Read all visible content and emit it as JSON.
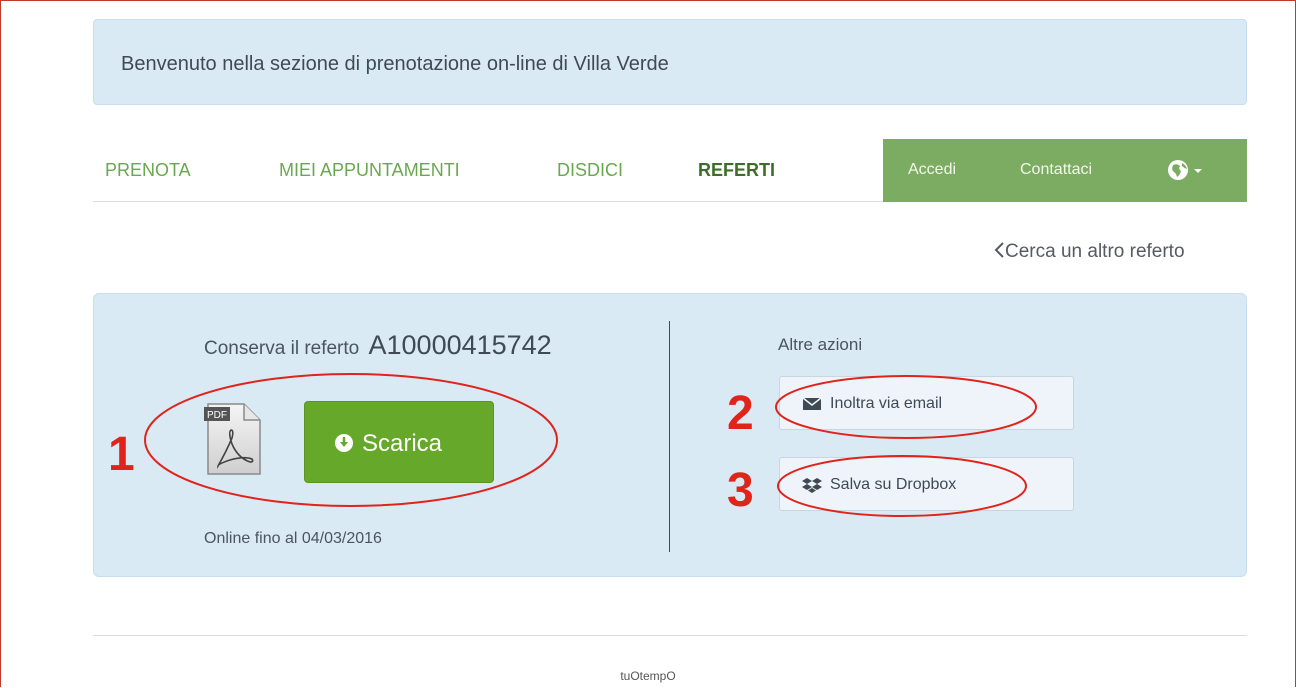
{
  "welcome": {
    "text": "Benvenuto nella sezione di prenotazione on-line di Villa Verde"
  },
  "nav": {
    "items": [
      {
        "label": "PRENOTA"
      },
      {
        "label": "MIEI APPUNTAMENTI"
      },
      {
        "label": "DISDICI"
      },
      {
        "label": "REFERTI",
        "active": true
      }
    ],
    "right": {
      "login": "Accedi",
      "contact": "Contattaci",
      "language_icon": "globe-icon"
    }
  },
  "back_link": {
    "label": "Cerca un altro referto",
    "icon": "chevron-left-icon"
  },
  "report": {
    "title_prefix": "Conserva il referto",
    "code": "A10000415742",
    "file_icon": "pdf-file-icon",
    "download_label": "Scarica",
    "download_icon": "download-circle-icon",
    "online_until": "Online fino al 04/03/2016"
  },
  "actions": {
    "title": "Altre azioni",
    "email_label": "Inoltra via email",
    "email_icon": "envelope-icon",
    "dropbox_label": "Salva su Dropbox",
    "dropbox_icon": "dropbox-icon"
  },
  "annotations": {
    "one": "1",
    "two": "2",
    "three": "3",
    "color": "#e0241b"
  },
  "footer": {
    "text": "tuOtempO"
  },
  "colors": {
    "green_primary": "#66a82a",
    "nav_green": "#6aa84f",
    "navbar_bg": "#7cac61",
    "panel_bg": "#d9eaf5"
  }
}
